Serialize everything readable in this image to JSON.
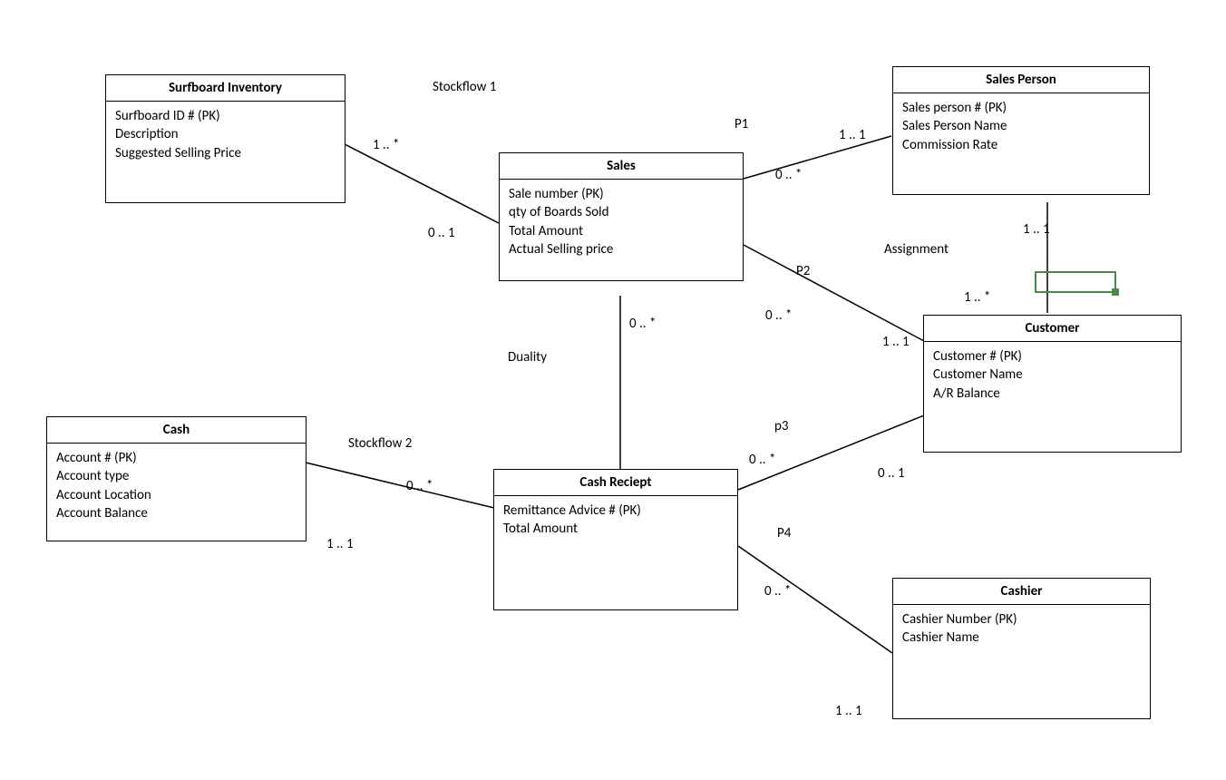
{
  "entities": {
    "surfboard": {
      "title": "Surfboard Inventory",
      "attrs": [
        "Surfboard ID # (PK)",
        "Description",
        "Suggested Selling Price"
      ]
    },
    "sales": {
      "title": "Sales",
      "attrs": [
        "Sale number (PK)",
        "qty of Boards Sold",
        "Total Amount",
        "Actual Selling price"
      ]
    },
    "salesperson": {
      "title": "Sales Person",
      "attrs": [
        "Sales person # (PK)",
        "Sales Person Name",
        "Commission Rate"
      ]
    },
    "customer": {
      "title": "Customer",
      "attrs": [
        "Customer # (PK)",
        "Customer Name",
        "A/R Balance"
      ]
    },
    "cash": {
      "title": "Cash",
      "attrs": [
        "Account # (PK)",
        "Account type",
        "Account Location",
        "Account Balance"
      ]
    },
    "cashreceipt": {
      "title": "Cash Reciept",
      "attrs": [
        "Remittance Advice # (PK)",
        "Total Amount"
      ]
    },
    "cashier": {
      "title": "Cashier",
      "attrs": [
        "Cashier Number (PK)",
        "Cashier Name"
      ]
    }
  },
  "labels": {
    "stockflow1": "Stockflow 1",
    "p1": "P1",
    "assignment": "Assignment",
    "p2": "P2",
    "duality": "Duality",
    "p3": "p3",
    "stockflow2": "Stockflow 2",
    "p4": "P4"
  },
  "mult": {
    "surf_sales_surf": "1 .. *",
    "surf_sales_sales": "0 .. 1",
    "sales_sp_sales": "0 .. *",
    "sales_sp_sp": "1 .. 1",
    "sales_cust_sales": "0 .. *",
    "sales_cust_cust": "1 .. 1",
    "sales_cr_sales": "0 .. *",
    "cash_cr_cr": "0 .. *",
    "cash_cr_cash": "1 .. 1",
    "cr_cust_cr": "0 .. *",
    "cr_cust_cust": "0 .. 1",
    "cr_cashier_cr": "0 .. *",
    "cr_cashier_cashier": "1 .. 1",
    "sp_cust_sp": "1 .. 1",
    "sp_cust_cust": "1 .. *"
  }
}
